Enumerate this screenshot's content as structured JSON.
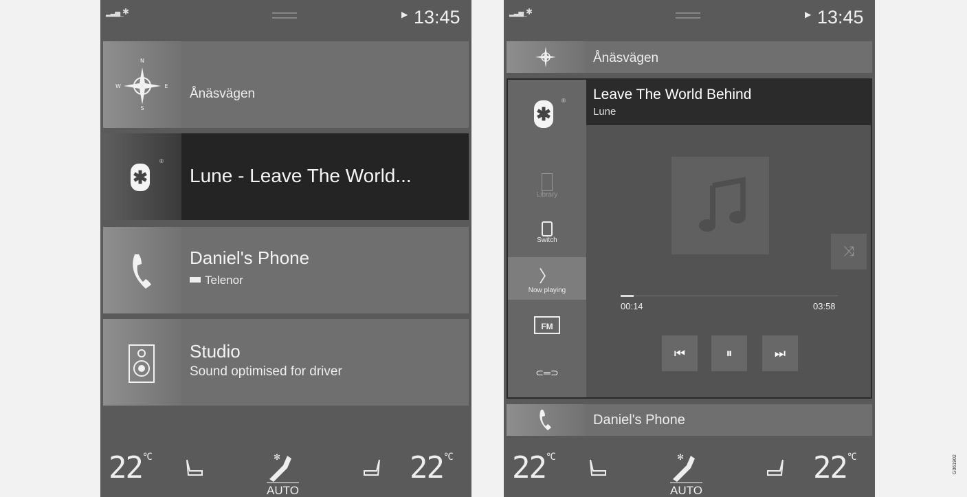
{
  "status": {
    "time": "13:45"
  },
  "left": {
    "tiles": [
      {
        "icon": "compass-icon",
        "label": "Ånäsvägen",
        "compass": {
          "n": "N",
          "e": "E",
          "s": "S",
          "w": "W"
        }
      },
      {
        "icon": "bluetooth-icon",
        "label": "Lune - Leave The World..."
      },
      {
        "icon": "phone-icon",
        "label": "Daniel's Phone",
        "sub": "Telenor"
      },
      {
        "icon": "speaker-icon",
        "label": "Studio",
        "sub": "Sound optimised for driver"
      }
    ]
  },
  "right": {
    "nav_label": "Ånäsvägen",
    "track_title": "Leave The World Behind",
    "artist": "Lune",
    "side": {
      "library": "Library",
      "switch": "Switch",
      "now_playing": "Now playing",
      "fm": "FM"
    },
    "progress": {
      "elapsed": "00:14",
      "total": "03:58",
      "fraction": 0.06
    },
    "phone_label": "Daniel's Phone"
  },
  "climate": {
    "left_temp": "22",
    "right_temp": "22",
    "unit": "°C",
    "mode": "AUTO"
  },
  "figure_code": "G061902",
  "colors": {
    "background": "#5a5a5a",
    "active_tile": "#242424"
  }
}
